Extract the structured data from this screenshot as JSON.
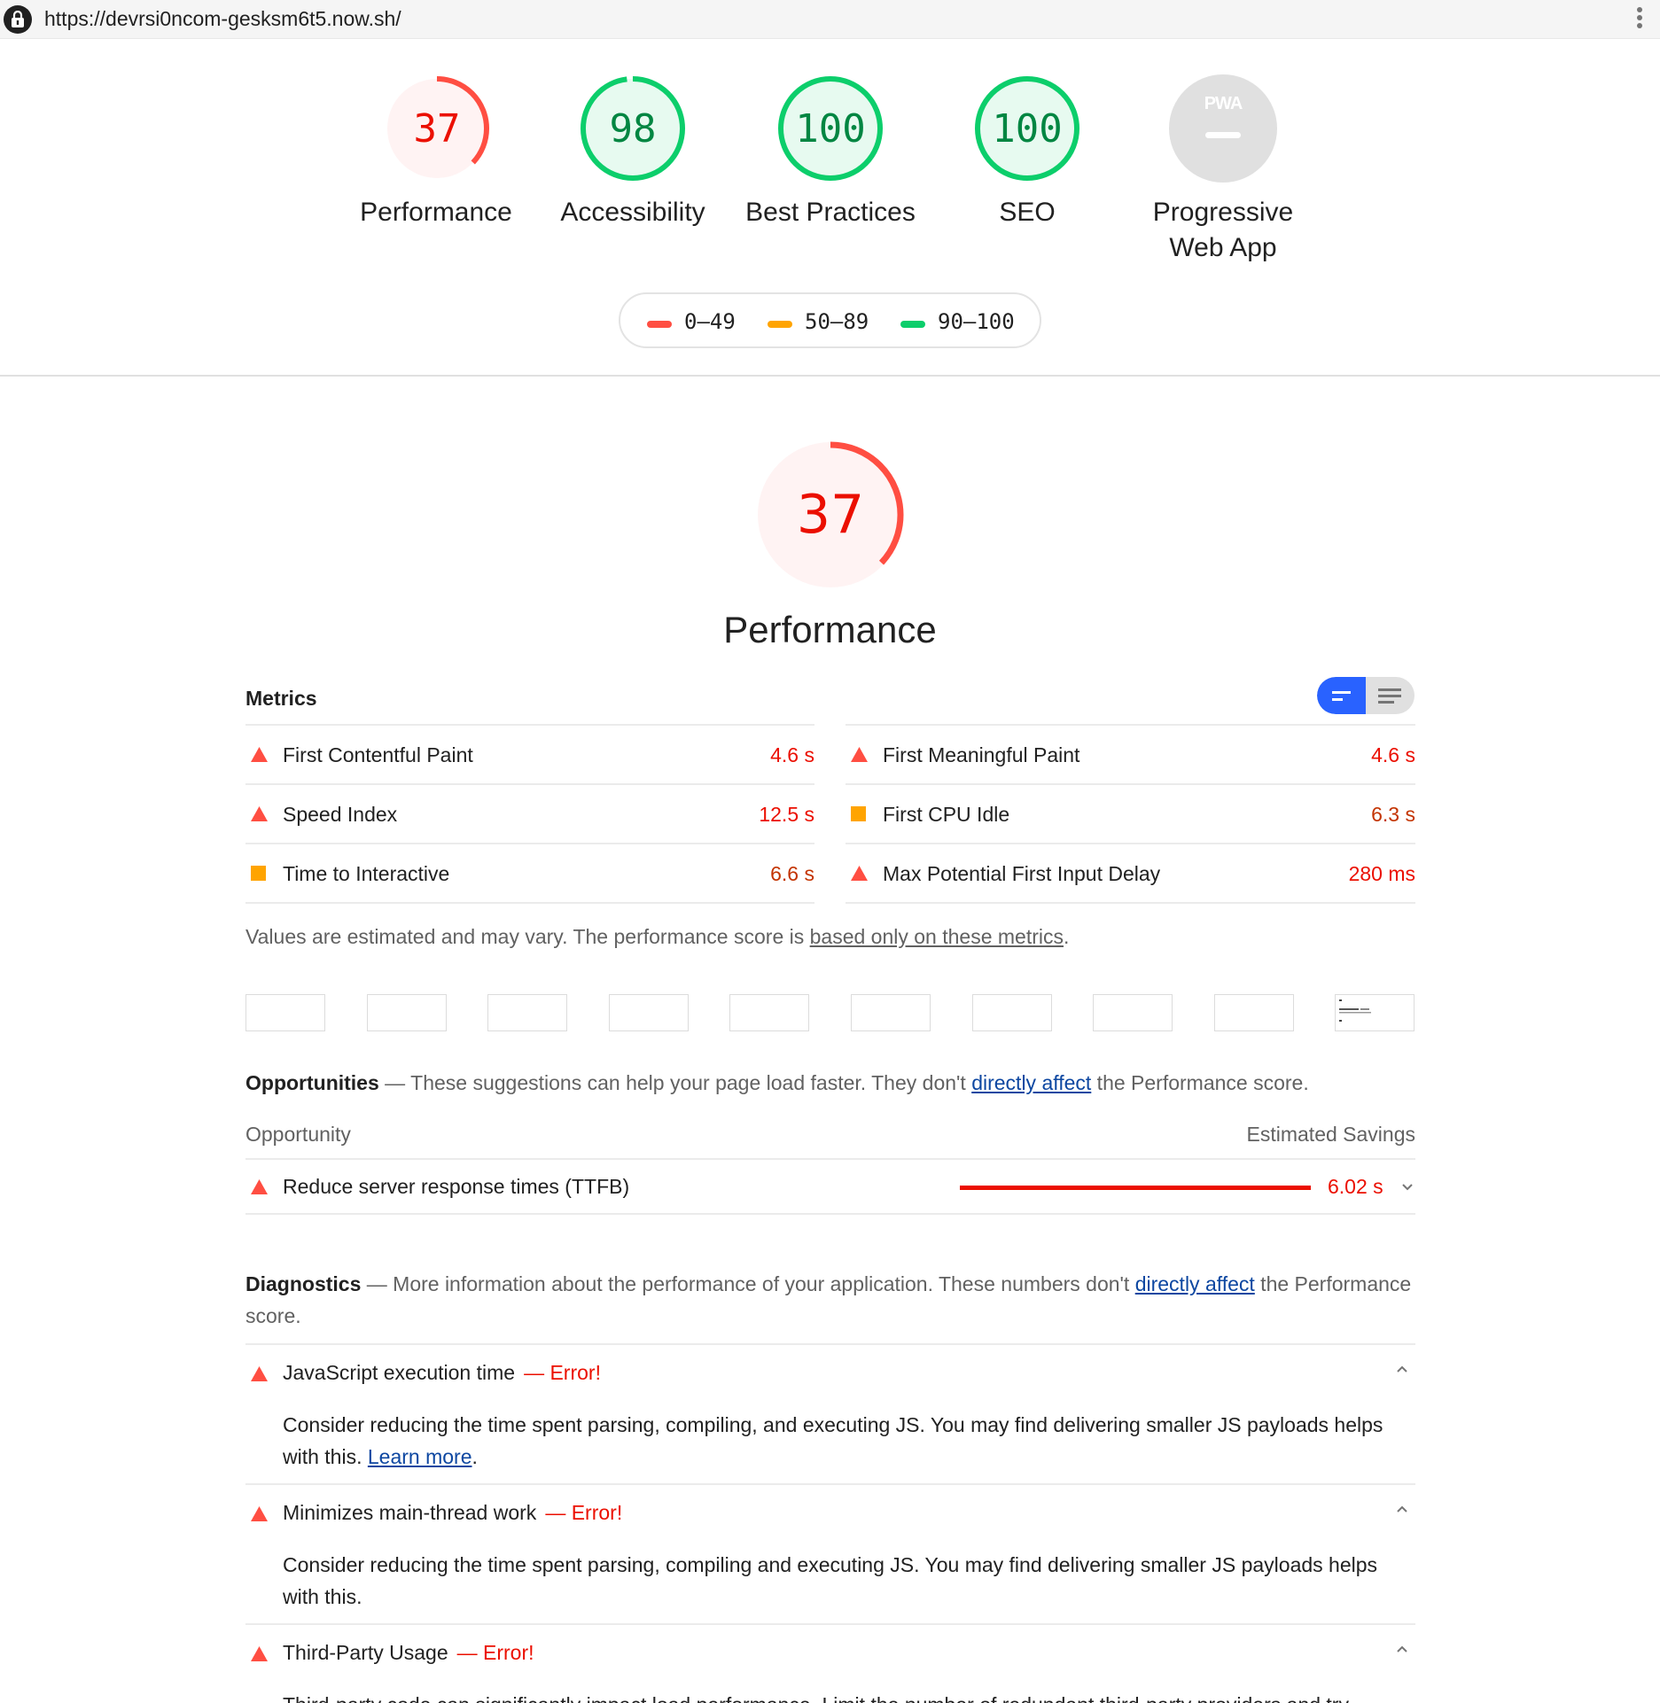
{
  "browser": {
    "url": "https://devrsi0ncom-gesksm6t5.now.sh/"
  },
  "gauges": [
    {
      "label_line1": "Performance",
      "label_line2": "",
      "score": "37",
      "value": 37,
      "color": "#ff4e42"
    },
    {
      "label_line1": "Accessibility",
      "label_line2": "",
      "score": "98",
      "value": 98,
      "color": "#0cce6b"
    },
    {
      "label_line1": "Best Practices",
      "label_line2": "",
      "score": "100",
      "value": 100,
      "color": "#0cce6b"
    },
    {
      "label_line1": "SEO",
      "label_line2": "",
      "score": "100",
      "value": 100,
      "color": "#0cce6b"
    },
    {
      "label_line1": "Progressive",
      "label_line2": "Web App",
      "score": "PWA",
      "value": null,
      "color": "#cccccc"
    }
  ],
  "legend": {
    "fail": "0–49",
    "average": "50–89",
    "pass": "90–100",
    "colors": {
      "fail": "#ff4e42",
      "average": "#ffa400",
      "pass": "#0cce6b"
    }
  },
  "performance": {
    "score": "37",
    "value": 37,
    "title": "Performance"
  },
  "metrics": {
    "title": "Metrics",
    "left": [
      {
        "name": "First Contentful Paint",
        "value": "4.6 s",
        "status": "fail"
      },
      {
        "name": "Speed Index",
        "value": "12.5 s",
        "status": "fail"
      },
      {
        "name": "Time to Interactive",
        "value": "6.6 s",
        "status": "average"
      }
    ],
    "right": [
      {
        "name": "First Meaningful Paint",
        "value": "4.6 s",
        "status": "fail"
      },
      {
        "name": "First CPU Idle",
        "value": "6.3 s",
        "status": "average"
      },
      {
        "name": "Max Potential First Input Delay",
        "value": "280 ms",
        "status": "fail"
      }
    ],
    "note_prefix": "Values are estimated and may vary. The performance score is ",
    "note_link": "based only on these metrics",
    "note_suffix": "."
  },
  "opportunities": {
    "title": "Opportunities",
    "desc_prefix": " — These suggestions can help your page load faster. They don't ",
    "desc_link": "directly affect",
    "desc_suffix": " the Performance score.",
    "col_left": "Opportunity",
    "col_right": "Estimated Savings",
    "items": [
      {
        "name": "Reduce server response times (TTFB)",
        "value": "6.02 s"
      }
    ]
  },
  "diagnostics": {
    "title": "Diagnostics",
    "desc_prefix": " — More information about the performance of your application. These numbers don't ",
    "desc_link": "directly affect",
    "desc_suffix": " the Performance score.",
    "error_label": "— Error!",
    "items": [
      {
        "name": "JavaScript execution time",
        "desc": "Consider reducing the time spent parsing, compiling, and executing JS. You may find delivering smaller JS payloads helps with this.",
        "link": "Learn more",
        "link_suffix": "."
      },
      {
        "name": "Minimizes main-thread work",
        "desc": "Consider reducing the time spent parsing, compiling and executing JS. You may find delivering smaller JS payloads helps with this.",
        "link": "",
        "link_suffix": ""
      },
      {
        "name": "Third-Party Usage",
        "desc": "Third-party code can significantly impact load performance. Limit the number of redundant third-party providers and try",
        "link": "",
        "link_suffix": ""
      }
    ]
  }
}
